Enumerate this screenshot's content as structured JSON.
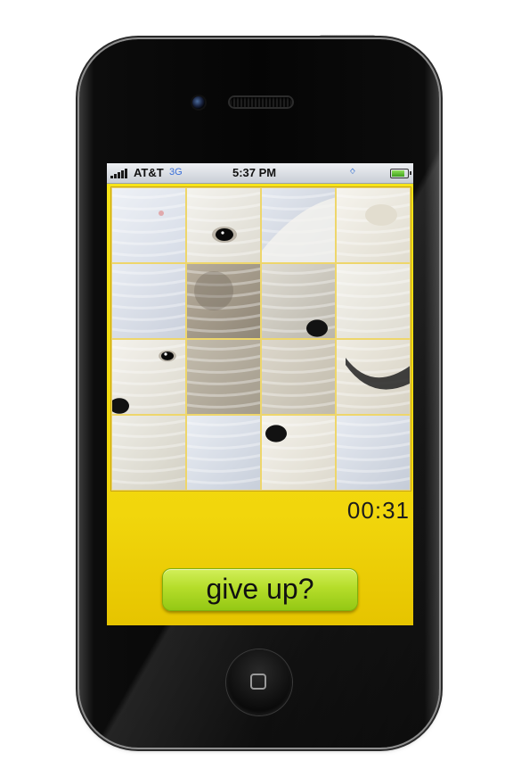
{
  "device": {
    "icons": [
      "front-camera-icon",
      "earpiece-speaker-icon",
      "home-button-icon"
    ]
  },
  "status_bar": {
    "carrier": "AT&T",
    "network": "3G",
    "time": "5:37 PM",
    "bluetooth_icon": "bluetooth-icon",
    "signal_bars": 5,
    "battery_level": 0.8,
    "battery_color": "#5cc22a",
    "network_color": "#3a6fd8"
  },
  "game": {
    "background_color": "#f4dc10",
    "puzzle": {
      "grid_size": 4,
      "image_subject": "polar bears",
      "tile_count": 16
    },
    "timer": "00:31",
    "give_up_label": "give up?",
    "give_up_color": "#b5dd2a"
  }
}
